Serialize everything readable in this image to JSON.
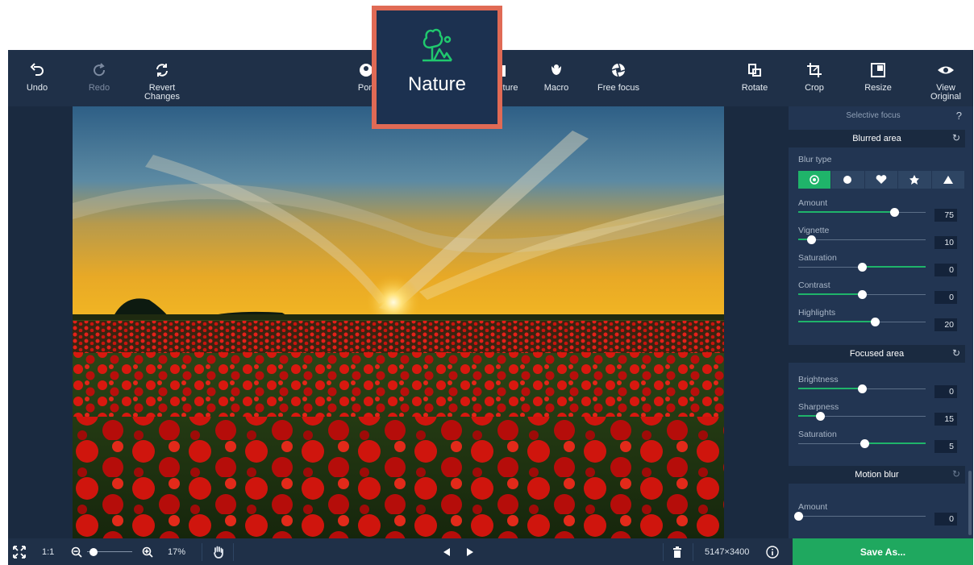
{
  "toolbar": {
    "undo": "Undo",
    "redo": "Redo",
    "revert_line1": "Revert",
    "revert_line2": "Changes",
    "portrait": "Port",
    "nature": "ture",
    "macro": "Macro",
    "free_focus": "Free focus",
    "rotate": "Rotate",
    "crop": "Crop",
    "resize": "Resize",
    "view_line1": "View",
    "view_line2": "Original"
  },
  "callout": {
    "label": "Nature"
  },
  "panel": {
    "title": "Selective focus",
    "help": "?",
    "blurred": {
      "header": "Blurred area",
      "blur_type_label": "Blur type",
      "blur_types": [
        "circle-icon",
        "ellipse-icon",
        "heart-icon",
        "star-icon",
        "triangle-icon"
      ],
      "blur_type_selected": 0,
      "sliders": [
        {
          "label": "Amount",
          "value": "75",
          "level": 0.75
        },
        {
          "label": "Vignette",
          "value": "10",
          "level": 0.1
        },
        {
          "label": "Saturation",
          "value": "0",
          "level": 0.5,
          "centered": true
        },
        {
          "label": "Contrast",
          "value": "0",
          "level": 0.5
        },
        {
          "label": "Highlights",
          "value": "20",
          "level": 0.6
        }
      ]
    },
    "focused": {
      "header": "Focused area",
      "sliders": [
        {
          "label": "Brightness",
          "value": "0",
          "level": 0.5
        },
        {
          "label": "Sharpness",
          "value": "15",
          "level": 0.17
        },
        {
          "label": "Saturation",
          "value": "5",
          "level": 0.52,
          "centered": true
        }
      ]
    },
    "motion": {
      "header": "Motion blur",
      "sliders": [
        {
          "label": "Amount",
          "value": "0",
          "level": 0.0
        }
      ]
    }
  },
  "status": {
    "one_to_one": "1:1",
    "zoom": "17%",
    "zoom_level": 0.15,
    "dimensions": "5147×3400",
    "save_as": "Save As..."
  },
  "colors": {
    "accent": "#1fb46a",
    "toolbar_bg": "#1f3048",
    "panel_bg": "#223552",
    "callout_border": "#e06a55"
  }
}
